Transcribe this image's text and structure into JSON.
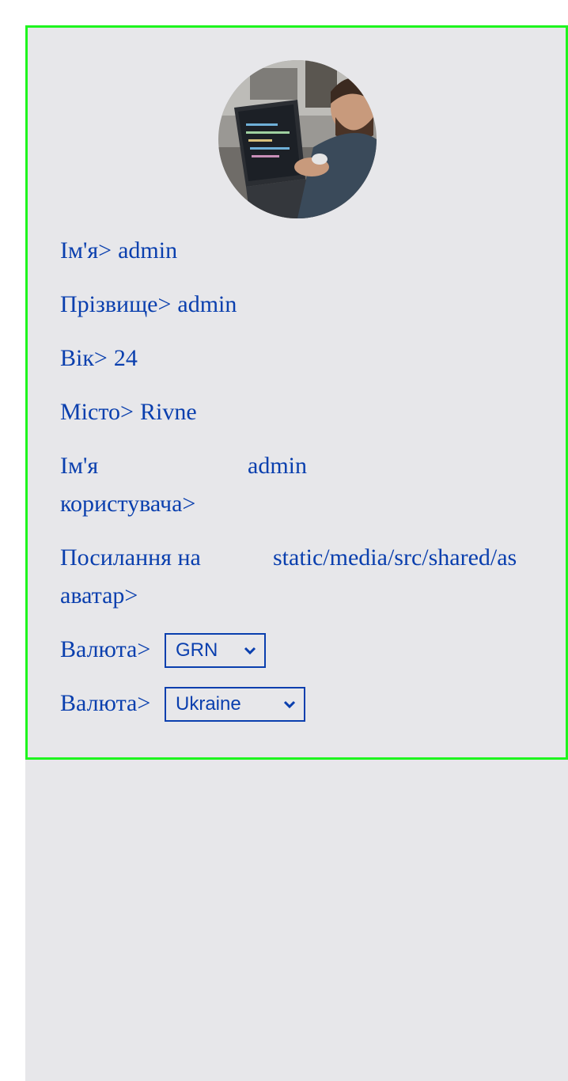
{
  "profile": {
    "fields": {
      "first_name": {
        "label": "Ім'я>",
        "value": "admin"
      },
      "last_name": {
        "label": "Прізвище>",
        "value": "admin"
      },
      "age": {
        "label": "Вік>",
        "value": "24"
      },
      "city": {
        "label": "Місто>",
        "value": "Rivne"
      },
      "username": {
        "label_line1": "Ім'я",
        "label_line2": "користувача>",
        "value": "admin"
      },
      "avatar_link": {
        "label_line1": "Посилання на",
        "label_line2": "аватар>",
        "value": "static/media/src/shared/as"
      }
    },
    "currency_select": {
      "label": "Валюта>",
      "selected": "GRN"
    },
    "country_select": {
      "label": "Валюта>",
      "selected": "Ukraine"
    }
  },
  "icons": {
    "avatar": "avatar-photo",
    "dropdown": "chevron-down-icon"
  },
  "colors": {
    "text": "#0a3fae",
    "card_border": "#1ef51e",
    "background": "#e7e7ea"
  }
}
